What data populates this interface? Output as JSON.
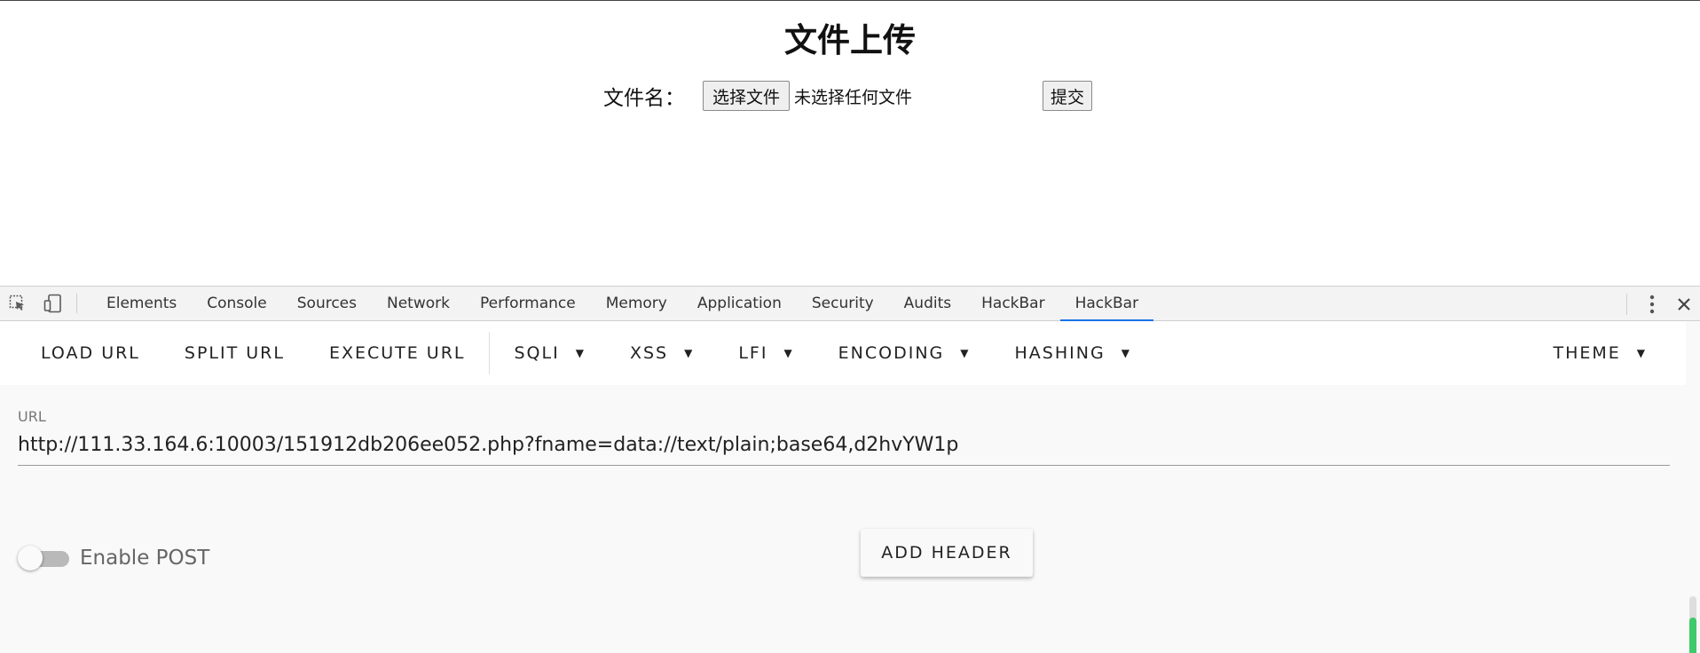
{
  "page": {
    "title": "文件上传",
    "file_label": "文件名：",
    "choose_file_label": "选择文件",
    "no_file_text": "未选择任何文件",
    "submit_label": "提交"
  },
  "devtools": {
    "tabs": [
      {
        "label": "Elements"
      },
      {
        "label": "Console"
      },
      {
        "label": "Sources"
      },
      {
        "label": "Network"
      },
      {
        "label": "Performance"
      },
      {
        "label": "Memory"
      },
      {
        "label": "Application"
      },
      {
        "label": "Security"
      },
      {
        "label": "Audits"
      },
      {
        "label": "HackBar"
      },
      {
        "label": "HackBar"
      }
    ],
    "active_tab_index": 10,
    "active_tab_color": "#1a73e8",
    "icons": [
      "inspect-element-icon",
      "device-toolbar-icon",
      "more-options-icon",
      "close-icon"
    ]
  },
  "hackbar": {
    "toolbar": {
      "load_url": "LOAD URL",
      "split_url": "SPLIT URL",
      "execute_url": "EXECUTE URL",
      "sqli": "SQLI",
      "xss": "XSS",
      "lfi": "LFI",
      "encoding": "ENCODING",
      "hashing": "HASHING",
      "theme": "THEME"
    },
    "url_label": "URL",
    "url_value": "http://111.33.164.6:10003/151912db206ee052.php?fname=data://text/plain;base64,d2hvYW1p",
    "enable_post_label": "Enable POST",
    "enable_post": false,
    "add_header_label": "ADD HEADER",
    "scroll_color": "#3ec96a"
  }
}
